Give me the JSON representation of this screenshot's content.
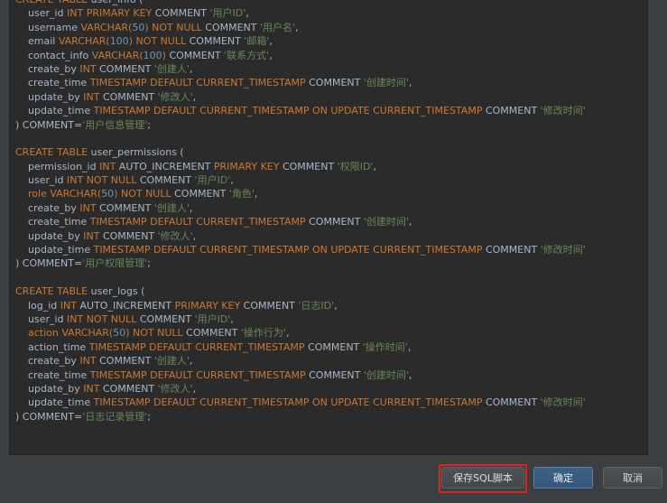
{
  "editor": {
    "lines": [
      [
        [
          "kw",
          "CREATE TABLE "
        ],
        [
          "id",
          "user_info ("
        ]
      ],
      [
        [
          "id",
          "    user_id "
        ],
        [
          "kw",
          "INT PRIMARY KEY "
        ],
        [
          "id",
          "COMMENT "
        ],
        [
          "str",
          "'用户ID'"
        ],
        [
          "id",
          ","
        ]
      ],
      [
        [
          "id",
          "    username "
        ],
        [
          "kw",
          "VARCHAR("
        ],
        [
          "num",
          "50"
        ],
        [
          "kw",
          ") NOT NULL "
        ],
        [
          "id",
          "COMMENT "
        ],
        [
          "str",
          "'用户名'"
        ],
        [
          "id",
          ","
        ]
      ],
      [
        [
          "id",
          "    email "
        ],
        [
          "kw",
          "VARCHAR("
        ],
        [
          "num",
          "100"
        ],
        [
          "kw",
          ") NOT NULL "
        ],
        [
          "id",
          "COMMENT "
        ],
        [
          "str",
          "'邮箱'"
        ],
        [
          "id",
          ","
        ]
      ],
      [
        [
          "id",
          "    contact_info "
        ],
        [
          "kw",
          "VARCHAR("
        ],
        [
          "num",
          "100"
        ],
        [
          "kw",
          ") "
        ],
        [
          "id",
          "COMMENT "
        ],
        [
          "str",
          "'联系方式'"
        ],
        [
          "id",
          ","
        ]
      ],
      [
        [
          "id",
          "    create_by "
        ],
        [
          "kw",
          "INT "
        ],
        [
          "id",
          "COMMENT "
        ],
        [
          "str",
          "'创建人'"
        ],
        [
          "id",
          ","
        ]
      ],
      [
        [
          "id",
          "    create_time "
        ],
        [
          "kw",
          "TIMESTAMP DEFAULT CURRENT_TIMESTAMP "
        ],
        [
          "id",
          "COMMENT "
        ],
        [
          "str",
          "'创建时间'"
        ],
        [
          "id",
          ","
        ]
      ],
      [
        [
          "id",
          "    update_by "
        ],
        [
          "kw",
          "INT "
        ],
        [
          "id",
          "COMMENT "
        ],
        [
          "str",
          "'修改人'"
        ],
        [
          "id",
          ","
        ]
      ],
      [
        [
          "id",
          "    update_time "
        ],
        [
          "kw",
          "TIMESTAMP DEFAULT CURRENT_TIMESTAMP ON UPDATE CURRENT_TIMESTAMP "
        ],
        [
          "id",
          "COMMENT "
        ],
        [
          "str",
          "'修改时间'"
        ]
      ],
      [
        [
          "id",
          ") COMMENT="
        ],
        [
          "str",
          "'用户信息管理'"
        ],
        [
          "id",
          ";"
        ]
      ],
      [],
      [
        [
          "kw",
          "CREATE TABLE "
        ],
        [
          "id",
          "user_permissions ("
        ]
      ],
      [
        [
          "id",
          "    permission_id "
        ],
        [
          "kw",
          "INT "
        ],
        [
          "id",
          "AUTO_INCREMENT "
        ],
        [
          "kw",
          "PRIMARY KEY "
        ],
        [
          "id",
          "COMMENT "
        ],
        [
          "str",
          "'权限ID'"
        ],
        [
          "id",
          ","
        ]
      ],
      [
        [
          "id",
          "    user_id "
        ],
        [
          "kw",
          "INT NOT NULL "
        ],
        [
          "id",
          "COMMENT "
        ],
        [
          "str",
          "'用户ID'"
        ],
        [
          "id",
          ","
        ]
      ],
      [
        [
          "id",
          "    "
        ],
        [
          "kw",
          "role VARCHAR("
        ],
        [
          "num",
          "50"
        ],
        [
          "kw",
          ") NOT NULL "
        ],
        [
          "id",
          "COMMENT "
        ],
        [
          "str",
          "'角色'"
        ],
        [
          "id",
          ","
        ]
      ],
      [
        [
          "id",
          "    create_by "
        ],
        [
          "kw",
          "INT "
        ],
        [
          "id",
          "COMMENT "
        ],
        [
          "str",
          "'创建人'"
        ],
        [
          "id",
          ","
        ]
      ],
      [
        [
          "id",
          "    create_time "
        ],
        [
          "kw",
          "TIMESTAMP DEFAULT CURRENT_TIMESTAMP "
        ],
        [
          "id",
          "COMMENT "
        ],
        [
          "str",
          "'创建时间'"
        ],
        [
          "id",
          ","
        ]
      ],
      [
        [
          "id",
          "    update_by "
        ],
        [
          "kw",
          "INT "
        ],
        [
          "id",
          "COMMENT "
        ],
        [
          "str",
          "'修改人'"
        ],
        [
          "id",
          ","
        ]
      ],
      [
        [
          "id",
          "    update_time "
        ],
        [
          "kw",
          "TIMESTAMP DEFAULT CURRENT_TIMESTAMP ON UPDATE CURRENT_TIMESTAMP "
        ],
        [
          "id",
          "COMMENT "
        ],
        [
          "str",
          "'修改时间'"
        ]
      ],
      [
        [
          "id",
          ") COMMENT="
        ],
        [
          "str",
          "'用户权限管理'"
        ],
        [
          "id",
          ";"
        ]
      ],
      [],
      [
        [
          "kw",
          "CREATE TABLE "
        ],
        [
          "id",
          "user_logs ("
        ]
      ],
      [
        [
          "id",
          "    log_id "
        ],
        [
          "kw",
          "INT "
        ],
        [
          "id",
          "AUTO_INCREMENT "
        ],
        [
          "kw",
          "PRIMARY KEY "
        ],
        [
          "id",
          "COMMENT "
        ],
        [
          "str",
          "'日志ID'"
        ],
        [
          "id",
          ","
        ]
      ],
      [
        [
          "id",
          "    user_id "
        ],
        [
          "kw",
          "INT NOT NULL "
        ],
        [
          "id",
          "COMMENT "
        ],
        [
          "str",
          "'用户ID'"
        ],
        [
          "id",
          ","
        ]
      ],
      [
        [
          "id",
          "    "
        ],
        [
          "kw",
          "action VARCHAR("
        ],
        [
          "num",
          "50"
        ],
        [
          "kw",
          ") NOT NULL "
        ],
        [
          "id",
          "COMMENT "
        ],
        [
          "str",
          "'操作行为'"
        ],
        [
          "id",
          ","
        ]
      ],
      [
        [
          "id",
          "    action_time "
        ],
        [
          "kw",
          "TIMESTAMP DEFAULT CURRENT_TIMESTAMP "
        ],
        [
          "id",
          "COMMENT "
        ],
        [
          "str",
          "'操作时间'"
        ],
        [
          "id",
          ","
        ]
      ],
      [
        [
          "id",
          "    create_by "
        ],
        [
          "kw",
          "INT "
        ],
        [
          "id",
          "COMMENT "
        ],
        [
          "str",
          "'创建人'"
        ],
        [
          "id",
          ","
        ]
      ],
      [
        [
          "id",
          "    create_time "
        ],
        [
          "kw",
          "TIMESTAMP DEFAULT CURRENT_TIMESTAMP "
        ],
        [
          "id",
          "COMMENT "
        ],
        [
          "str",
          "'创建时间'"
        ],
        [
          "id",
          ","
        ]
      ],
      [
        [
          "id",
          "    update_by "
        ],
        [
          "kw",
          "INT "
        ],
        [
          "id",
          "COMMENT "
        ],
        [
          "str",
          "'修改人'"
        ],
        [
          "id",
          ","
        ]
      ],
      [
        [
          "id",
          "    update_time "
        ],
        [
          "kw",
          "TIMESTAMP DEFAULT CURRENT_TIMESTAMP ON UPDATE CURRENT_TIMESTAMP "
        ],
        [
          "id",
          "COMMENT "
        ],
        [
          "str",
          "'修改时间'"
        ]
      ],
      [
        [
          "id",
          ") COMMENT="
        ],
        [
          "str",
          "'日志记录管理'"
        ],
        [
          "id",
          ";"
        ]
      ]
    ]
  },
  "buttons": {
    "save_sql": "保存SQL脚本",
    "ok": "确定",
    "cancel": "取消"
  },
  "colors": {
    "keyword": "#cc7832",
    "identifier": "#a9b7c6",
    "string": "#6a8759",
    "number": "#6897bb",
    "highlight": "#e0201c"
  }
}
